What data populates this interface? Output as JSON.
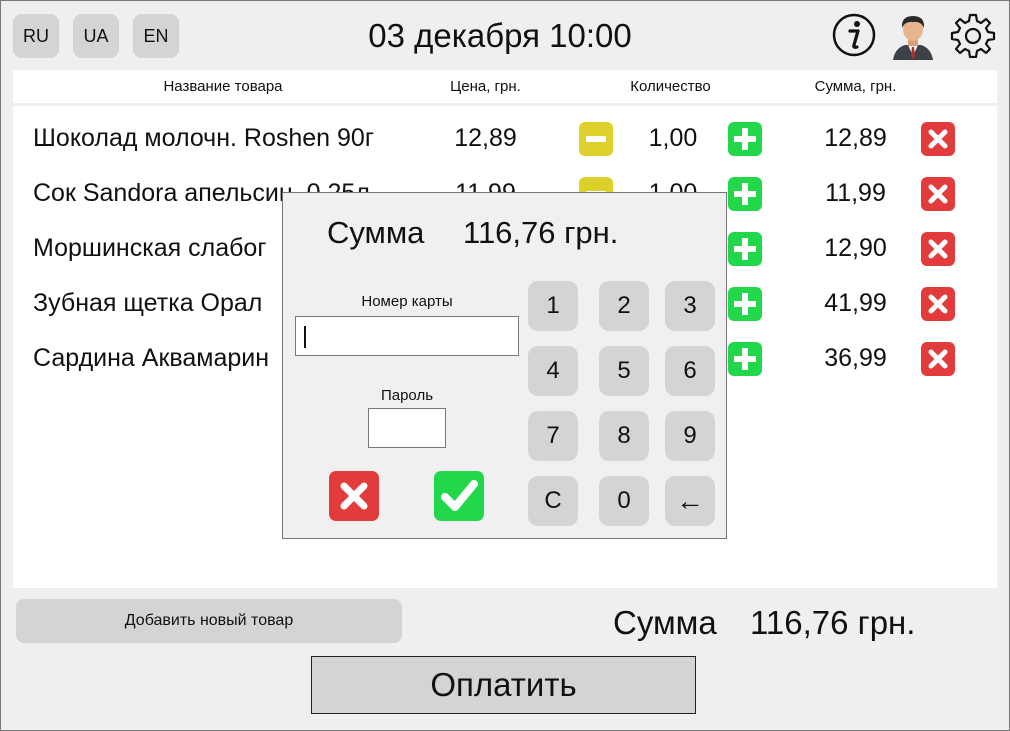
{
  "languages": [
    "RU",
    "UA",
    "EN"
  ],
  "datetime": "03 декабря 10:00",
  "icons": {
    "info": "info-icon",
    "user": "user-avatar-icon",
    "settings": "gear-icon"
  },
  "table": {
    "headers": {
      "name": "Название товара",
      "price": "Цена, грн.",
      "qty": "Количество",
      "sum": "Сумма, грн."
    },
    "rows": [
      {
        "name": "Шоколад молочн. Roshen 90г",
        "price": "12,89",
        "qty": "1,00",
        "sum": "12,89"
      },
      {
        "name": "Сок Sandora апельсин. 0,25л",
        "price": "11,99",
        "qty": "1,00",
        "sum": "11,99"
      },
      {
        "name": "Моршинская слабог",
        "price": "",
        "qty": "",
        "sum": "12,90"
      },
      {
        "name": "Зубная щетка Орал",
        "price": "",
        "qty": "",
        "sum": "41,99"
      },
      {
        "name": "Сардина Аквамарин",
        "price": "",
        "qty": "",
        "sum": "36,99"
      }
    ]
  },
  "add_button": "Добавить новый товар",
  "total": {
    "label": "Сумма",
    "value": "116,76 грн."
  },
  "pay_button": "Оплатить",
  "modal": {
    "sum_label": "Сумма",
    "sum_value": "116,76 грн.",
    "card_label": "Номер карты",
    "card_value": "",
    "password_label": "Пароль",
    "keypad": [
      "1",
      "2",
      "3",
      "4",
      "5",
      "6",
      "7",
      "8",
      "9",
      "C",
      "0",
      "←"
    ]
  },
  "colors": {
    "minus": "#ddd02a",
    "plus": "#22d84a",
    "delete": "#e23b3b",
    "button_gray": "#d4d4d4",
    "background": "#efefef"
  }
}
